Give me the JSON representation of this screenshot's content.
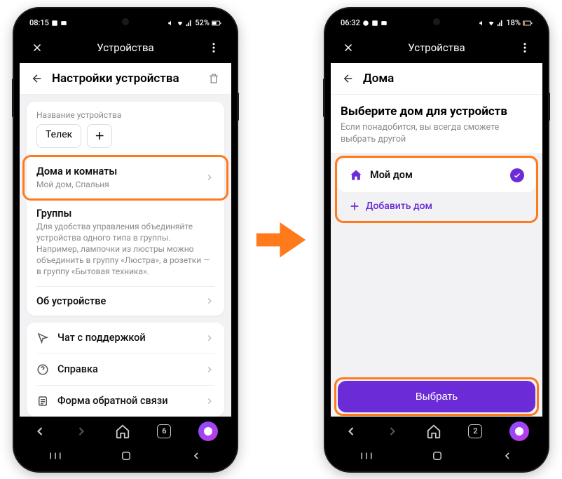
{
  "left": {
    "status": {
      "time": "08:15",
      "battery": "52%"
    },
    "header": {
      "title": "Устройства"
    },
    "page_title": "Настройки устройства",
    "device_name": {
      "label": "Название устройства",
      "value": "Телек"
    },
    "rooms": {
      "title": "Дома и комнаты",
      "sub": "Мой дом, Спальня"
    },
    "groups": {
      "title": "Группы",
      "sub": "Для удобства управления объединяйте устройства одного типа в группы. Например, лампочки из люстры можно объединить в группу «Люстра», а розетки — в группу «Бытовая техника»."
    },
    "about": "Об устройстве",
    "support_items": [
      "Чат с поддержкой",
      "Справка",
      "Форма обратной связи"
    ],
    "nav_tab_count": "6"
  },
  "right": {
    "status": {
      "time": "06:32",
      "battery": "18%"
    },
    "header": {
      "title": "Устройства"
    },
    "page_title": "Дома",
    "heading": "Выберите дом для устройств",
    "sub": "Если понадобится, вы всегда сможете выбрать другой",
    "home_name": "Мой дом",
    "add_home": "Добавить дом",
    "select_btn": "Выбрать",
    "nav_tab_count": "2"
  }
}
